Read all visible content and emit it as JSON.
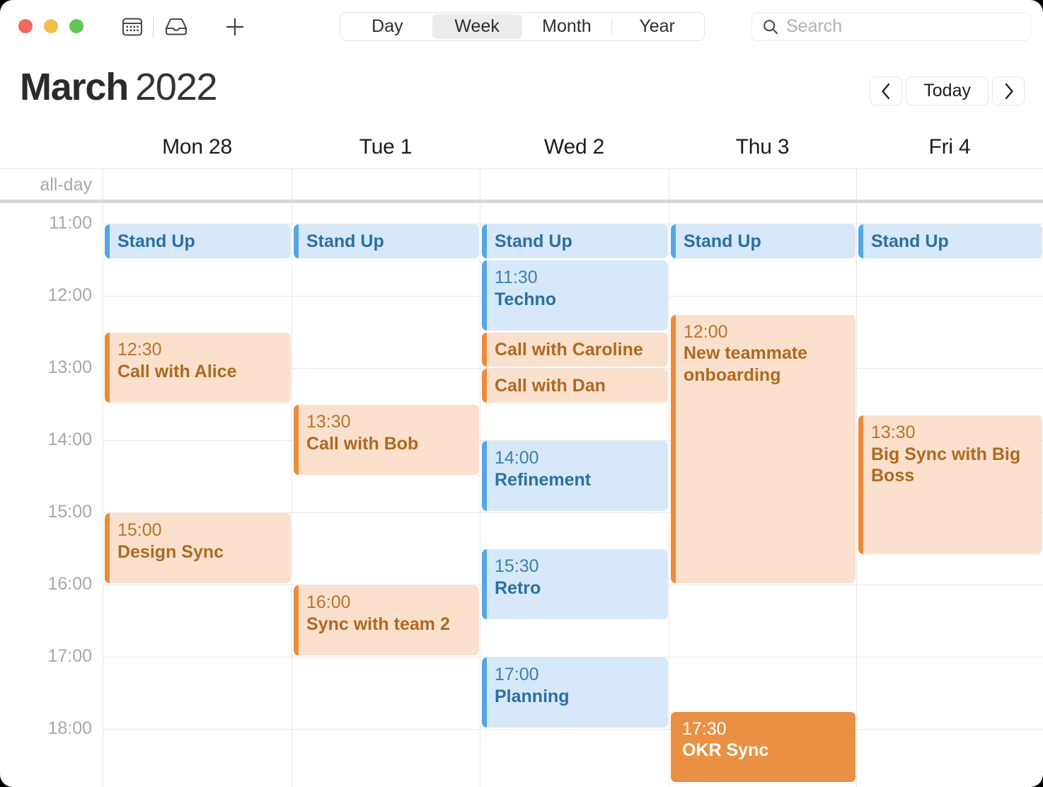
{
  "window": {
    "title": "Calendar"
  },
  "toolbar": {
    "traffic_lights": [
      {
        "name": "close",
        "color": "#ED6A5E"
      },
      {
        "name": "minimize",
        "color": "#F4BD4F"
      },
      {
        "name": "zoom",
        "color": "#61C554"
      }
    ],
    "calendar_icon": "calendar-icon",
    "inbox_icon": "inbox-icon",
    "add_icon": "plus-icon",
    "view_options": [
      {
        "label": "Day",
        "selected": false
      },
      {
        "label": "Week",
        "selected": true
      },
      {
        "label": "Month",
        "selected": false
      },
      {
        "label": "Year",
        "selected": false
      }
    ],
    "search": {
      "icon": "search-icon",
      "placeholder": "Search",
      "value": ""
    }
  },
  "header": {
    "month": "March",
    "year": "2022",
    "prev_label": "‹",
    "today_label": "Today",
    "next_label": "›"
  },
  "calendar": {
    "allday_label": "all-day",
    "days": [
      {
        "label": "Mon 28"
      },
      {
        "label": "Tue 1"
      },
      {
        "label": "Wed 2"
      },
      {
        "label": "Thu 3"
      },
      {
        "label": "Fri 4"
      }
    ],
    "hours": [
      "11:00",
      "12:00",
      "13:00",
      "14:00",
      "15:00",
      "16:00",
      "17:00",
      "18:00"
    ],
    "events": [
      {
        "day": 0,
        "time": "",
        "title": "Stand Up",
        "color": "blue",
        "start": 11.0,
        "end": 11.5,
        "compact": true
      },
      {
        "day": 0,
        "time": "12:30",
        "title": "Call with Alice",
        "color": "orange",
        "start": 12.5,
        "end": 13.5,
        "compact": false
      },
      {
        "day": 0,
        "time": "15:00",
        "title": "Design Sync",
        "color": "orange",
        "start": 15.0,
        "end": 16.0,
        "compact": false
      },
      {
        "day": 1,
        "time": "",
        "title": "Stand Up",
        "color": "blue",
        "start": 11.0,
        "end": 11.5,
        "compact": true
      },
      {
        "day": 1,
        "time": "13:30",
        "title": "Call with Bob",
        "color": "orange",
        "start": 13.5,
        "end": 14.5,
        "compact": false
      },
      {
        "day": 1,
        "time": "16:00",
        "title": "Sync with team 2",
        "color": "orange",
        "start": 16.0,
        "end": 17.0,
        "compact": false
      },
      {
        "day": 2,
        "time": "",
        "title": "Stand Up",
        "color": "blue",
        "start": 11.0,
        "end": 11.5,
        "compact": true
      },
      {
        "day": 2,
        "time": "11:30",
        "title": "Techno",
        "color": "blue",
        "start": 11.5,
        "end": 12.5,
        "compact": false
      },
      {
        "day": 2,
        "time": "",
        "title": "Call with Caroline",
        "color": "orange",
        "start": 12.5,
        "end": 13.0,
        "compact": true
      },
      {
        "day": 2,
        "time": "",
        "title": "Call with Dan",
        "color": "orange",
        "start": 13.0,
        "end": 13.5,
        "compact": true
      },
      {
        "day": 2,
        "time": "14:00",
        "title": "Refinement",
        "color": "blue",
        "start": 14.0,
        "end": 15.0,
        "compact": false
      },
      {
        "day": 2,
        "time": "15:30",
        "title": "Retro",
        "color": "blue",
        "start": 15.5,
        "end": 16.5,
        "compact": false
      },
      {
        "day": 2,
        "time": "17:00",
        "title": "Planning",
        "color": "blue",
        "start": 17.0,
        "end": 18.0,
        "compact": false
      },
      {
        "day": 3,
        "time": "",
        "title": "Stand Up",
        "color": "blue",
        "start": 11.0,
        "end": 11.5,
        "compact": true
      },
      {
        "day": 3,
        "time": "12:00",
        "title": "New teammate onboarding",
        "color": "orange",
        "start": 12.25,
        "end": 16.0,
        "compact": false
      },
      {
        "day": 3,
        "time": "17:30",
        "title": "OKR Sync",
        "color": "solid-orange",
        "start": 17.75,
        "end": 18.75,
        "compact": false
      },
      {
        "day": 4,
        "time": "",
        "title": "Stand Up",
        "color": "blue",
        "start": 11.0,
        "end": 11.5,
        "compact": true
      },
      {
        "day": 4,
        "time": "13:30",
        "title": "Big Sync with Big Boss",
        "color": "orange",
        "start": 13.65,
        "end": 15.6,
        "compact": false
      }
    ]
  },
  "colors": {
    "blue_accent": "#55A6E6",
    "blue_bg": "#D6E8F9",
    "orange_accent": "#ED8B37",
    "orange_bg": "#FAE0CD",
    "orange_solid": "#EA9044"
  }
}
